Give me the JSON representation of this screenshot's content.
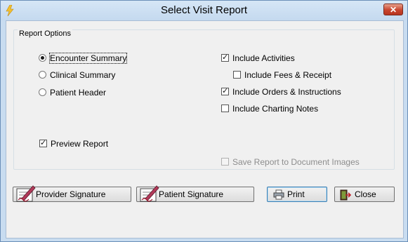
{
  "window": {
    "title": "Select Visit Report",
    "close_glyph": "✕"
  },
  "report_options": {
    "label": "Report Options",
    "radios": [
      {
        "label": "Encounter Summary",
        "selected": true
      },
      {
        "label": "Clinical Summary",
        "selected": false
      },
      {
        "label": "Patient Header",
        "selected": false
      }
    ],
    "preview": {
      "label": "Preview Report",
      "checked": true
    },
    "includes": [
      {
        "label": "Include Activities",
        "checked": true
      },
      {
        "label": "Include Fees & Receipt",
        "checked": false
      },
      {
        "label": "Include Orders & Instructions",
        "checked": true
      },
      {
        "label": "Include Charting Notes",
        "checked": false
      }
    ],
    "save_to_images": {
      "label": "Save Report to Document Images",
      "checked": false,
      "disabled": true
    }
  },
  "buttons": {
    "provider_signature": "Provider Signature",
    "patient_signature": "Patient Signature",
    "print": "Print",
    "close": "Close"
  },
  "icons": {
    "app": "lightning-icon",
    "signature": "signature-pen-icon",
    "print": "printer-icon",
    "close": "exit-door-icon"
  }
}
